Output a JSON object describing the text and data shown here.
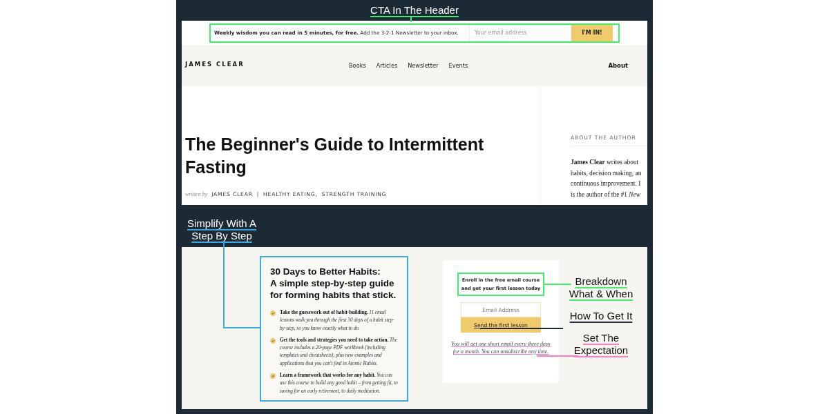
{
  "header_annotation": {
    "lines": [
      "CTA In The Header"
    ],
    "color": "#3ef06a"
  },
  "header_screenshot": {
    "cta_bar": {
      "message": "**Weekly wisdom you can read in 5 minutes, for free.** Add the 3-2-1 Newsletter to your inbox.",
      "email_placeholder": "Your email address",
      "button": "I'M IN!"
    },
    "nav": {
      "logo": "JAMES CLEAR",
      "links": [
        "Books",
        "Articles",
        "Newsletter",
        "Events"
      ],
      "about": "About"
    },
    "article": {
      "title": "The Beginner's Guide to Intermittent Fasting",
      "byline_prefix": "written by",
      "author": "JAMES CLEAR",
      "separator": "|",
      "categories": [
        "HEALTHY EATING,",
        "STRENGTH TRAINING"
      ]
    },
    "sidebar": {
      "heading": "ABOUT THE AUTHOR",
      "bio_lines": [
        "**James Clear** writes about",
        "habits, decision making, an",
        "continuous improvement. I",
        "is the author of the #1 *New*"
      ]
    }
  },
  "step_annotation": {
    "lines": [
      "Simplify With A",
      "Step By Step"
    ],
    "color": "#3aa9e0"
  },
  "course_screenshot": {
    "course": {
      "title_lines": [
        "30 Days to Better Habits:",
        "A simple step-by-step guide",
        "for forming habits that stick."
      ],
      "bullets": [
        "**Take the guesswork out of habit-building.** *11 email lessons walk you through the first 30 days of a habit step-by-step, so you know exactly what to do.*",
        "**Get the tools and strategies you need to take action.** *The course includes a 20-page PDF workbook (including templates and cheatsheets), plus new examples and applications that you can't find in Atomic Habits.*",
        "**Learn a framework that works for any habit.** *You can use this course to build any good habit – from getting fit, to saving for an early retirement, to daily meditation.*"
      ]
    },
    "form": {
      "heading": "Enroll in the free email course and get your first lesson today",
      "email_placeholder": "Email Address",
      "button": "Send the first lesson",
      "note": "You will get one short email every three days for a month. You can unsubscribe any time."
    }
  },
  "form_annotations": [
    {
      "lines": [
        "Breakdown",
        "What & When"
      ],
      "color": "#3ef06a"
    },
    {
      "lines": [
        "How To Get It"
      ],
      "color": "#1b2a35"
    },
    {
      "lines": [
        "Set The",
        "Expectation"
      ],
      "color": "#ff7ac0"
    }
  ]
}
